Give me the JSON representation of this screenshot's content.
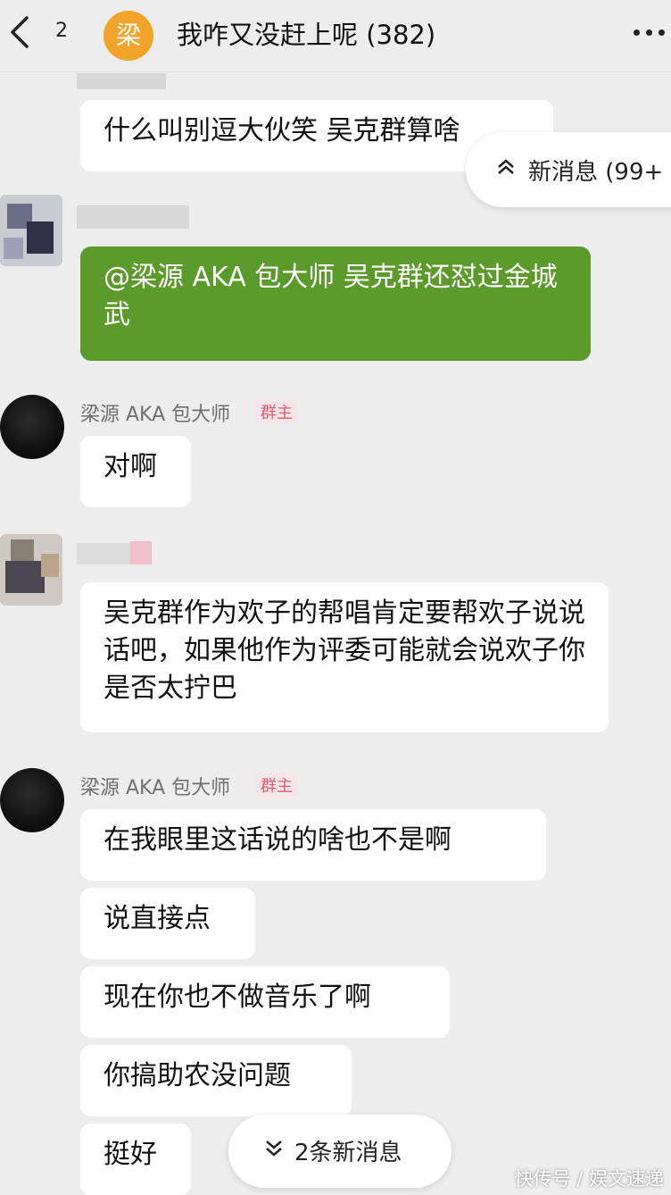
{
  "header": {
    "unread_count": "2",
    "avatar_char": "梁",
    "title": "我咋又没赶上呢 (382)",
    "back_icon": "chevron-left-icon",
    "more_icon": "more-dots-icon"
  },
  "messages": [
    {
      "text": "什么叫别逗大伙笑 吴克群算啥"
    },
    {
      "text": "@梁源 AKA 包大师 吴克群还怼过金城武"
    },
    {
      "sender": "梁源 AKA 包大师",
      "tag": "群主",
      "text": "对啊"
    },
    {
      "text": "吴克群作为欢子的帮唱肯定要帮欢子说说话吧，如果他作为评委可能就会说欢子你是否太拧巴"
    },
    {
      "sender": "梁源 AKA 包大师",
      "tag": "群主",
      "text": "在我眼里这话说的啥也不是啊"
    },
    {
      "text": "说直接点"
    },
    {
      "text": "现在你也不做音乐了啊"
    },
    {
      "text": "你搞助农没问题"
    },
    {
      "text": "挺好"
    }
  ],
  "new_messages_top": "新消息 (99+",
  "new_messages_bottom": "2条新消息",
  "watermark": "快传号 / 娱文速递",
  "colors": {
    "background": "#ededed",
    "green_bubble": "#5a9b2c",
    "owner_tag": "#e05a6f"
  }
}
